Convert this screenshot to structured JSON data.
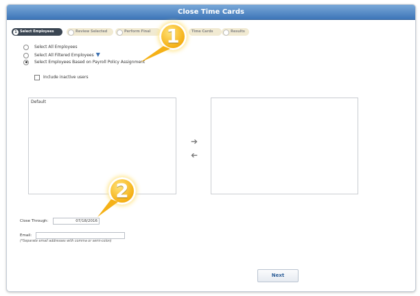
{
  "window": {
    "title": "Close Time Cards"
  },
  "steps": [
    {
      "number": "1",
      "label": "Select Employees",
      "state": "active"
    },
    {
      "number": "",
      "label": "Review Selected",
      "state": "inactive"
    },
    {
      "number": "",
      "label": "Perform Final",
      "state": "inactive"
    },
    {
      "number": "",
      "label": "Time Cards",
      "state": "inactive"
    },
    {
      "number": "",
      "label": "Results",
      "state": "inactive"
    }
  ],
  "options": {
    "all_employees": "Select All Employees",
    "filtered_employees": "Select All Filtered Employees",
    "policy_assignment": "Select Employees Based on Payroll Policy Assignment",
    "selected": "policy_assignment",
    "include_inactive": "Include inactive users"
  },
  "available_list": {
    "items": [
      "Default"
    ]
  },
  "selected_list": {
    "items": []
  },
  "move_right_icon": "arrow-right-icon",
  "move_left_icon": "arrow-left-icon",
  "close_through": {
    "label": "Close Through:",
    "value": "07/18/2016"
  },
  "email": {
    "label": "Email:",
    "value": "",
    "hint": "(*Separate email addresses with comma or semi-colon)"
  },
  "next_button": {
    "label": "Next"
  },
  "callouts": [
    "1",
    "2"
  ],
  "colors": {
    "title_bar": "#3d75b8",
    "active_step": "#3a4552",
    "callout": "#f5b117"
  }
}
